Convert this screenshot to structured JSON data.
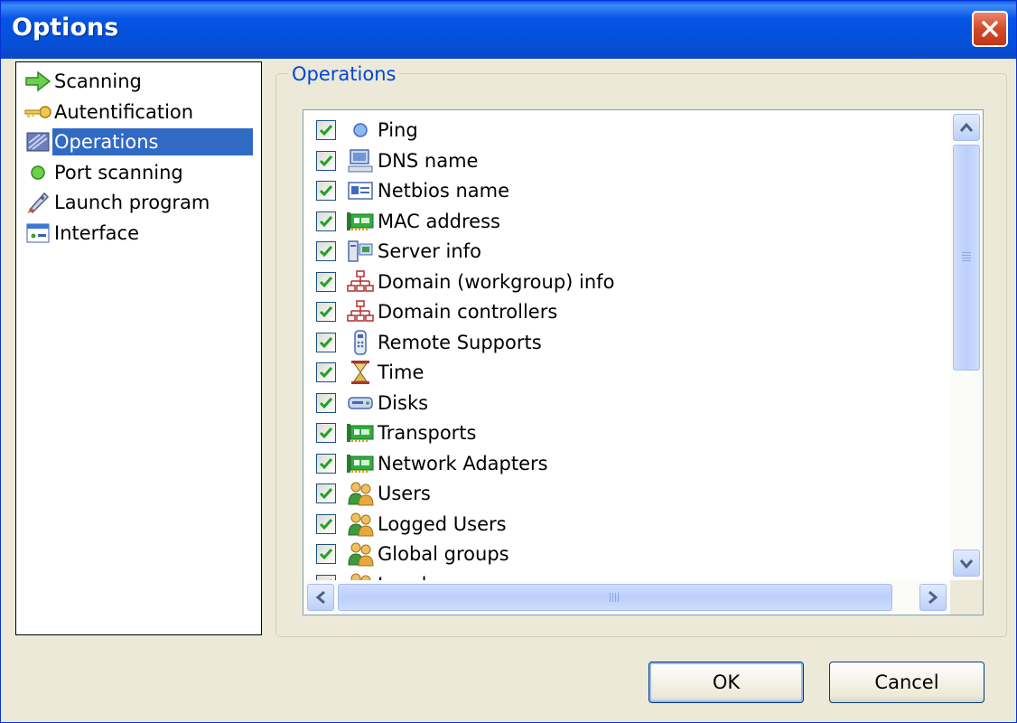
{
  "window": {
    "title": "Options"
  },
  "tree": {
    "items": [
      {
        "label": "Scanning",
        "icon": "green-arrow-icon"
      },
      {
        "label": "Autentification",
        "icon": "key-icon"
      },
      {
        "label": "Operations",
        "icon": "operations-icon",
        "selected": true
      },
      {
        "label": "Port scanning",
        "icon": "green-dot-icon"
      },
      {
        "label": "Launch program",
        "icon": "rocket-icon"
      },
      {
        "label": "Interface",
        "icon": "window-icon"
      }
    ]
  },
  "operations": {
    "group_title": "Operations",
    "items": [
      {
        "label": "Ping",
        "checked": true,
        "icon": "ping-dot-icon"
      },
      {
        "label": "DNS name",
        "checked": true,
        "icon": "computer-icon"
      },
      {
        "label": "Netbios name",
        "checked": true,
        "icon": "id-card-icon"
      },
      {
        "label": "MAC address",
        "checked": true,
        "icon": "network-card-icon"
      },
      {
        "label": "Server info",
        "checked": true,
        "icon": "server-icon"
      },
      {
        "label": "Domain (workgroup) info",
        "checked": true,
        "icon": "network-tree-icon"
      },
      {
        "label": "Domain controllers",
        "checked": true,
        "icon": "network-tree-icon"
      },
      {
        "label": "Remote Supports",
        "checked": true,
        "icon": "remote-icon"
      },
      {
        "label": "Time",
        "checked": true,
        "icon": "hourglass-icon"
      },
      {
        "label": "Disks",
        "checked": true,
        "icon": "disk-icon"
      },
      {
        "label": "Transports",
        "checked": true,
        "icon": "network-card-icon"
      },
      {
        "label": "Network Adapters",
        "checked": true,
        "icon": "network-card-icon"
      },
      {
        "label": "Users",
        "checked": true,
        "icon": "users-icon"
      },
      {
        "label": "Logged Users",
        "checked": true,
        "icon": "users-icon"
      },
      {
        "label": "Global groups",
        "checked": true,
        "icon": "users-icon"
      },
      {
        "label": "Local groups",
        "checked": true,
        "icon": "users-icon"
      }
    ]
  },
  "buttons": {
    "ok": "OK",
    "cancel": "Cancel"
  },
  "colors": {
    "titlebar": "#0655e6",
    "selection": "#316ac5",
    "check": "#21a121",
    "group_title": "#0046d5"
  }
}
